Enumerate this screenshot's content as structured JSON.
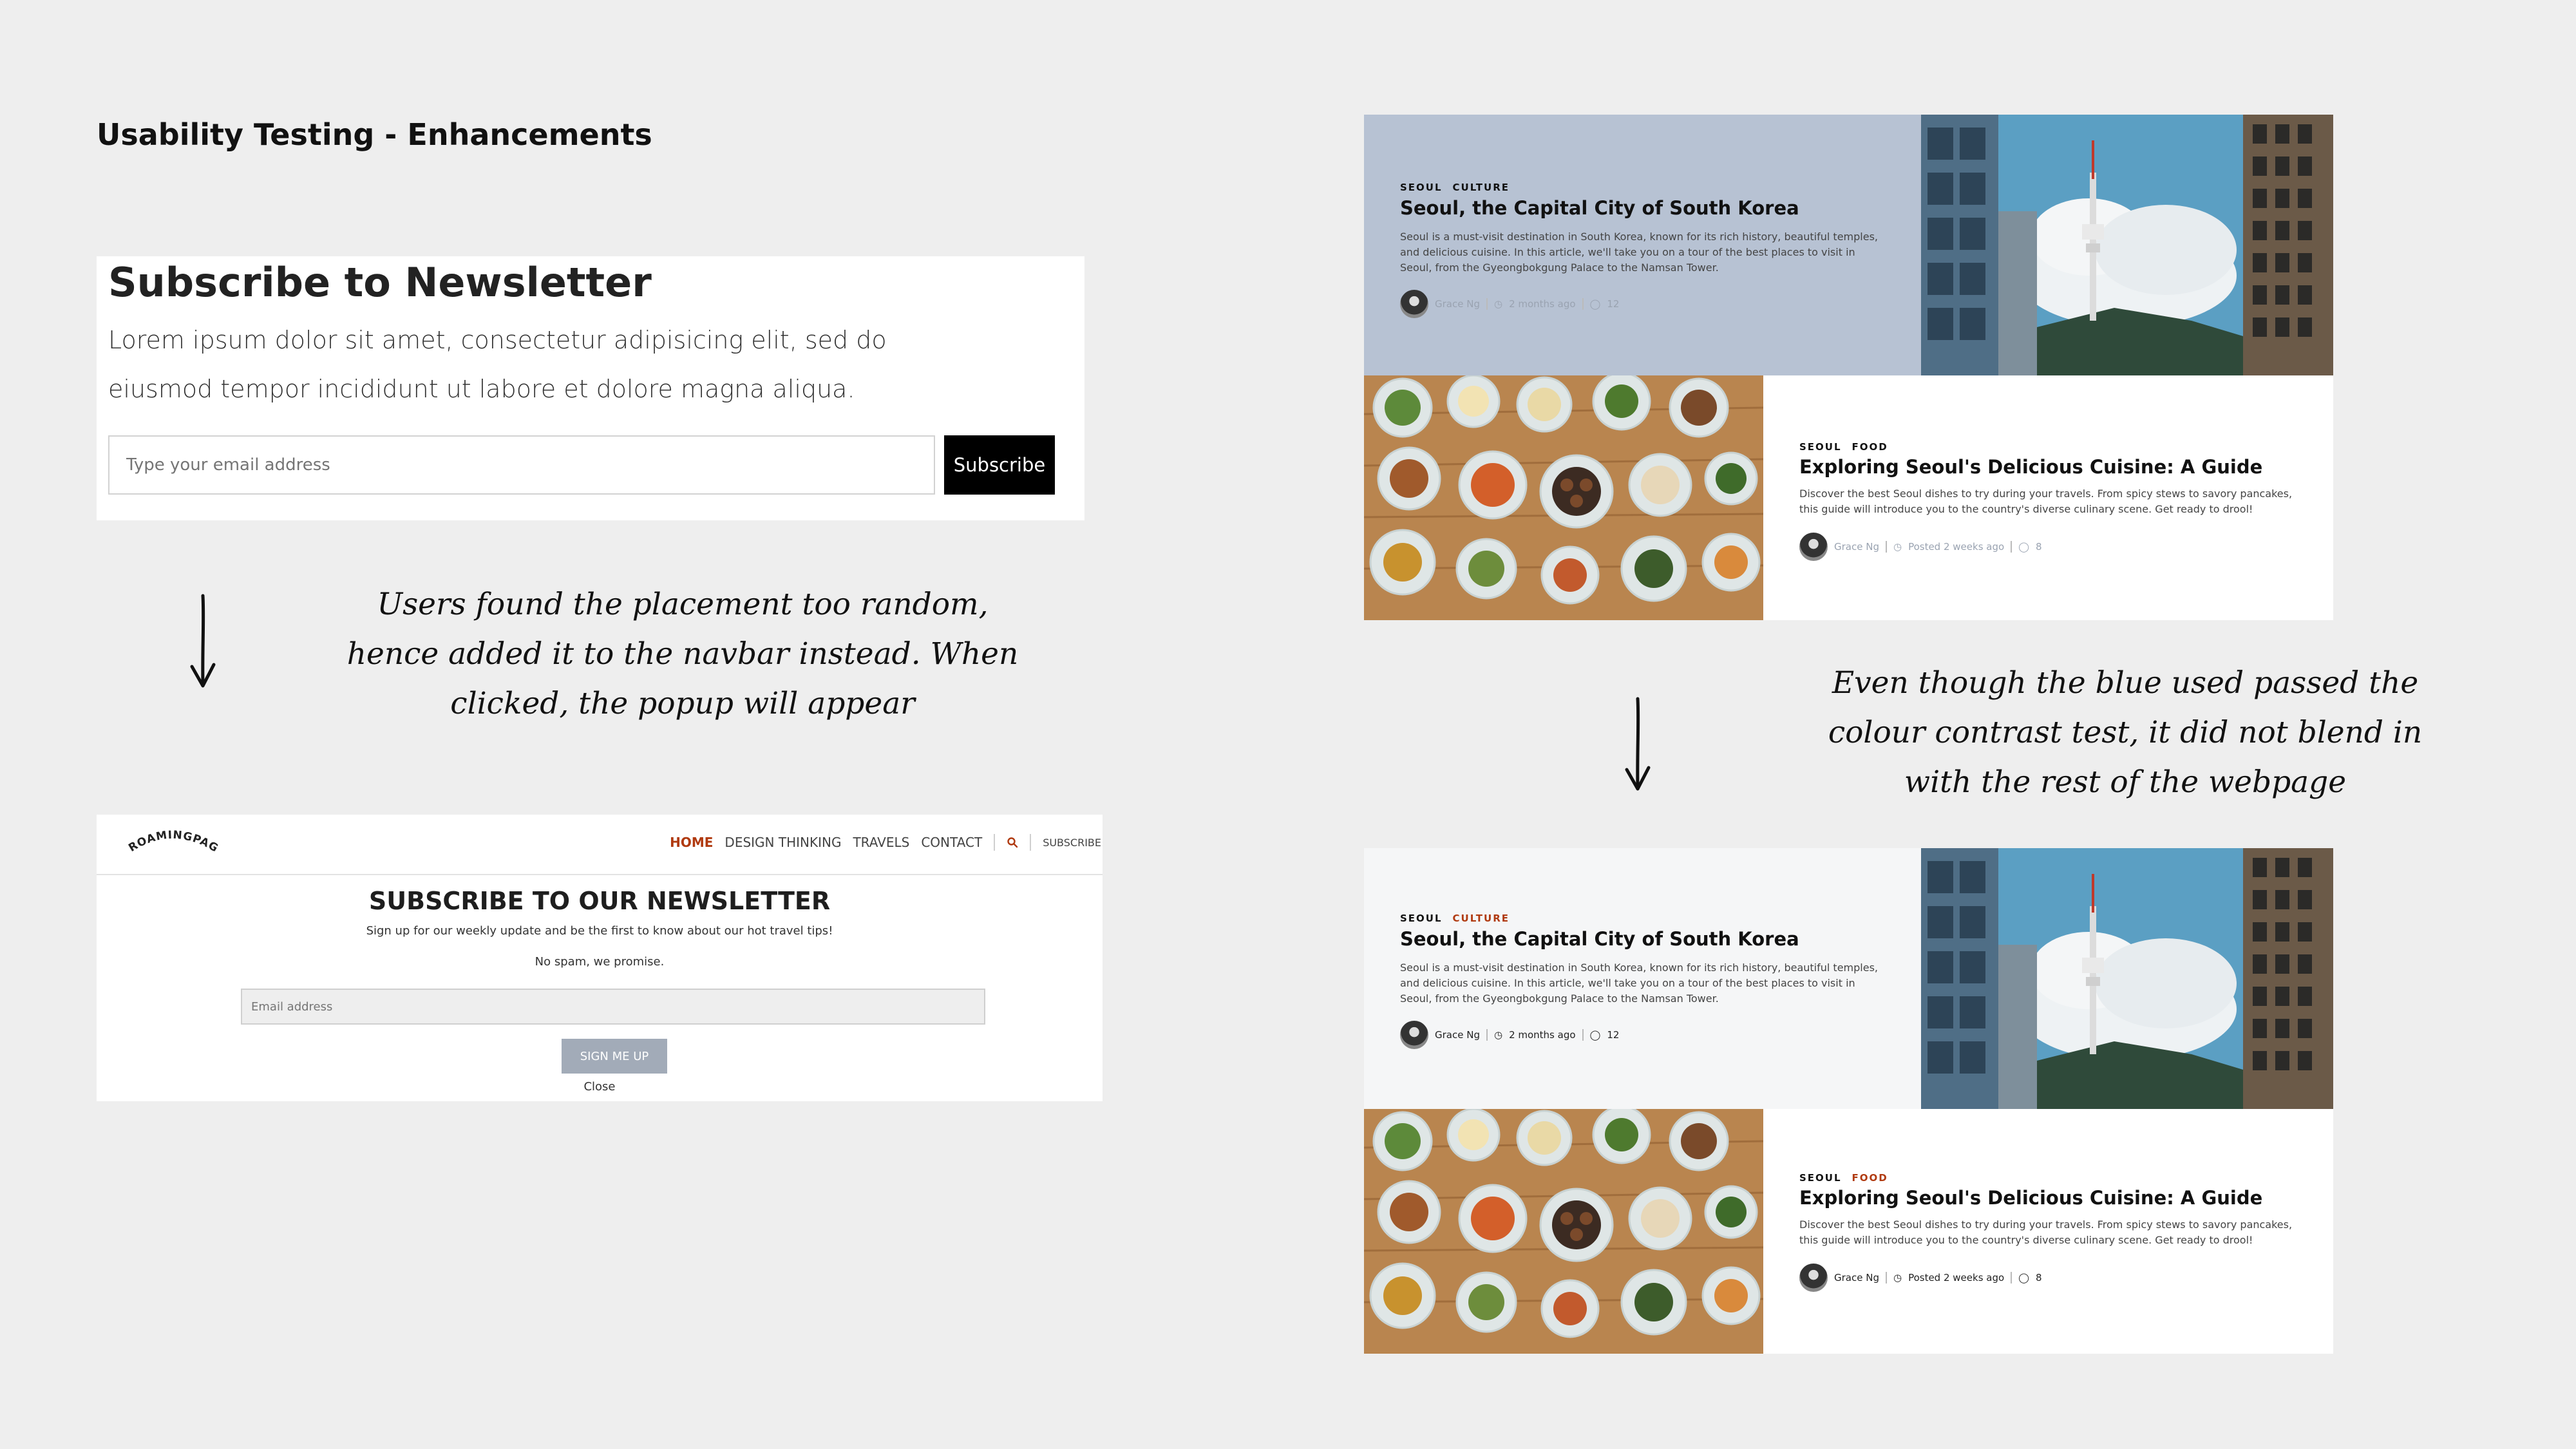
{
  "page_title": "Usability Testing - Enhancements",
  "old_subscribe": {
    "title": "Subscribe to Newsletter",
    "body": "Lorem ipsum dolor sit amet, consectetur adipisicing elit, sed do eiusmod tempor incididunt ut labore et dolore magna aliqua.",
    "input_placeholder": "Type your email address",
    "button_label": "Subscribe"
  },
  "note_left": "Users found the placement too random, hence added it to the navbar instead. When clicked, the popup will appear",
  "note_right": "Even though the blue used passed the colour contrast test, it did not blend in with the rest of the webpage",
  "new_popup": {
    "logo_text": "ROAMINGPAGES",
    "nav": [
      "HOME",
      "DESIGN THINKING",
      "TRAVELS",
      "CONTACT"
    ],
    "nav_subscribe": "SUBSCRIBE",
    "title": "SUBSCRIBE TO OUR NEWSLETTER",
    "subtitle": "Sign up for our weekly update and be the first to know about our hot travel tips!",
    "no_spam": "No spam, we promise.",
    "input_placeholder": "Email address",
    "button_label": "SIGN ME UP",
    "close_label": "Close"
  },
  "articles_before": {
    "accent_bg": "#b7c2d3",
    "tag_color": "#111111",
    "meta_color": "#9aa3b1",
    "article1": {
      "tags": [
        "SEOUL",
        "CULTURE"
      ],
      "title": "Seoul, the Capital City of South Korea",
      "desc": "Seoul is a must-visit destination in South Korea, known for its rich history, beautiful temples, and delicious cuisine. In this article, we'll take you on a tour of the best places to visit in Seoul, from the Gyeongbokgung Palace to the Namsan Tower.",
      "author": "Grace Ng",
      "time": "2 months ago",
      "comments": "12"
    },
    "article2": {
      "tags": [
        "SEOUL",
        "FOOD"
      ],
      "title": "Exploring Seoul's Delicious Cuisine: A Guide",
      "desc": "Discover the best Seoul dishes to try during your travels. From spicy stews to savory pancakes, this guide will introduce you to the country's diverse culinary scene. Get ready to drool!",
      "author": "Grace Ng",
      "time": "Posted 2 weeks ago",
      "comments": "8"
    }
  },
  "articles_after": {
    "accent_bg": "#f5f6f7",
    "tag_accent": "#b03a10",
    "meta_color": "#222222",
    "article1": {
      "tags": [
        "SEOUL",
        "CULTURE"
      ],
      "title": "Seoul, the Capital City of South Korea",
      "desc": "Seoul is a must-visit destination in South Korea, known for its rich history, beautiful temples, and delicious cuisine. In this article, we'll take you on a tour of the best places to visit in Seoul, from the Gyeongbokgung Palace to the Namsan Tower.",
      "author": "Grace Ng",
      "time": "2 months ago",
      "comments": "12"
    },
    "article2": {
      "tags": [
        "SEOUL",
        "FOOD"
      ],
      "title": "Exploring Seoul's Delicious Cuisine: A Guide",
      "desc": "Discover the best Seoul dishes to try during your travels. From spicy stews to savory pancakes, this guide will introduce you to the country's diverse culinary scene. Get ready to drool!",
      "author": "Grace Ng",
      "time": "Posted 2 weeks ago",
      "comments": "8"
    }
  }
}
